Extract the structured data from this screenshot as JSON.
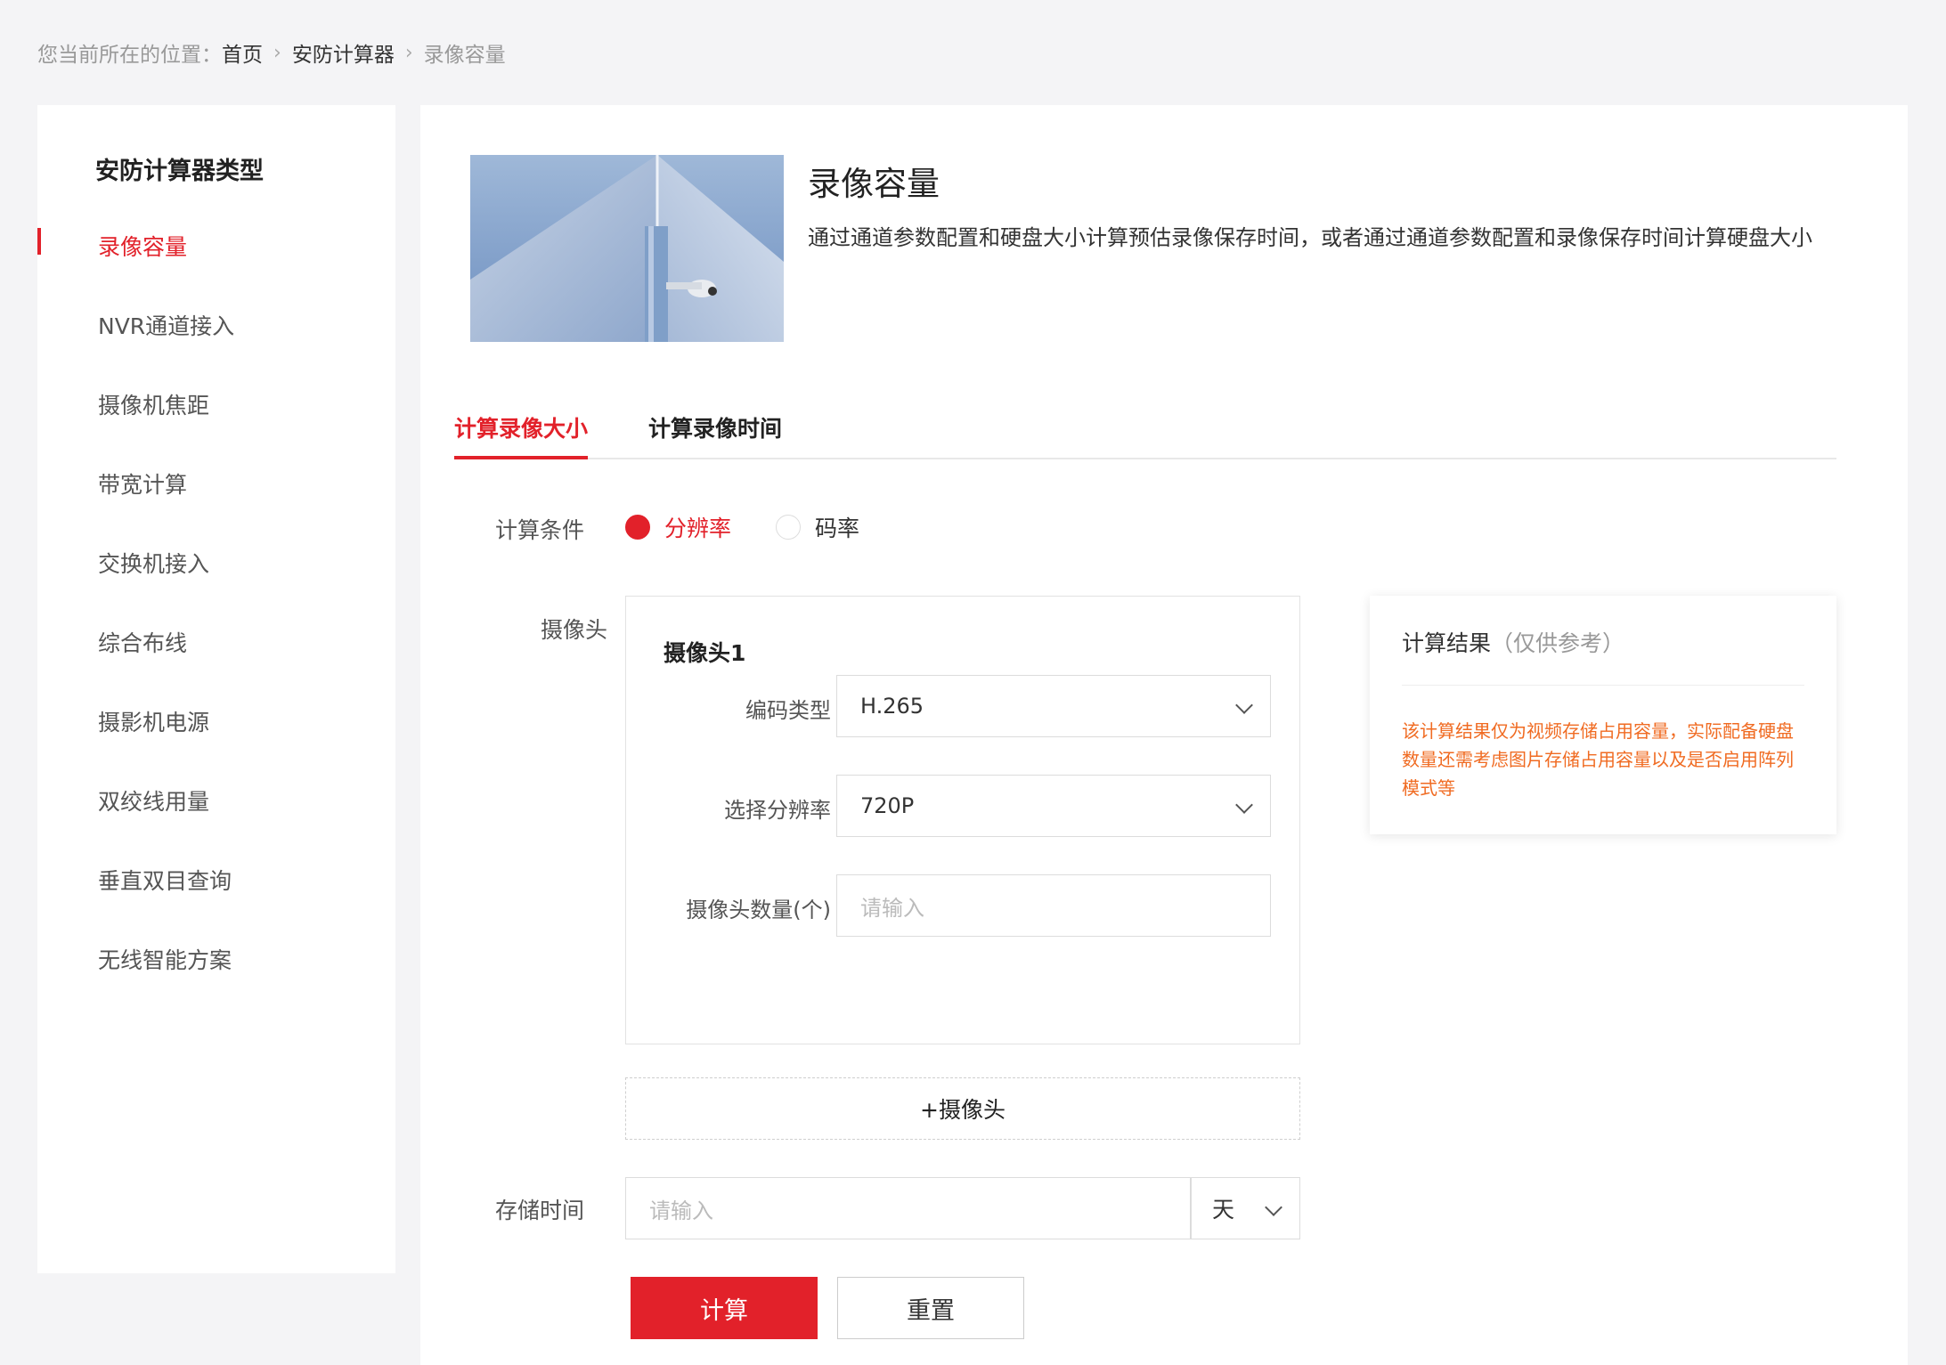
{
  "breadcrumb": {
    "prefix": "您当前所在的位置：",
    "items": [
      "首页",
      "安防计算器",
      "录像容量"
    ]
  },
  "sidebar": {
    "title": "安防计算器类型",
    "items": [
      {
        "label": "录像容量",
        "active": true
      },
      {
        "label": "NVR通道接入"
      },
      {
        "label": "摄像机焦距"
      },
      {
        "label": "带宽计算"
      },
      {
        "label": "交换机接入"
      },
      {
        "label": "综合布线"
      },
      {
        "label": "摄影机电源"
      },
      {
        "label": "双绞线用量"
      },
      {
        "label": "垂直双目查询"
      },
      {
        "label": "无线智能方案"
      }
    ]
  },
  "hero": {
    "title": "录像容量",
    "description": "通过通道参数配置和硬盘大小计算预估录像保存时间，或者通过通道参数配置和录像保存时间计算硬盘大小"
  },
  "tabs": [
    {
      "label": "计算录像大小",
      "active": true
    },
    {
      "label": "计算录像时间"
    }
  ],
  "form": {
    "condition_label": "计算条件",
    "condition_options": [
      {
        "label": "分辨率",
        "checked": true
      },
      {
        "label": "码率",
        "checked": false
      }
    ],
    "camera_label": "摄像头",
    "camera": {
      "title": "摄像头1",
      "codec_label": "编码类型",
      "codec_value": "H.265",
      "resolution_label": "选择分辨率",
      "resolution_value": "720P",
      "count_label": "摄像头数量(个)",
      "count_placeholder": "请输入"
    },
    "add_camera_label": "+摄像头",
    "storage_label": "存储时间",
    "storage_placeholder": "请输入",
    "storage_unit": "天",
    "calc_button": "计算",
    "reset_button": "重置"
  },
  "result": {
    "title": "计算结果",
    "subtitle": "（仅供参考）",
    "note": "该计算结果仅为视频存储占用容量，实际配备硬盘数量还需考虑图片存储占用容量以及是否启用阵列模式等"
  },
  "colors": {
    "accent": "#e2212a",
    "note": "#f06b22",
    "page_bg": "#f4f4f6"
  }
}
